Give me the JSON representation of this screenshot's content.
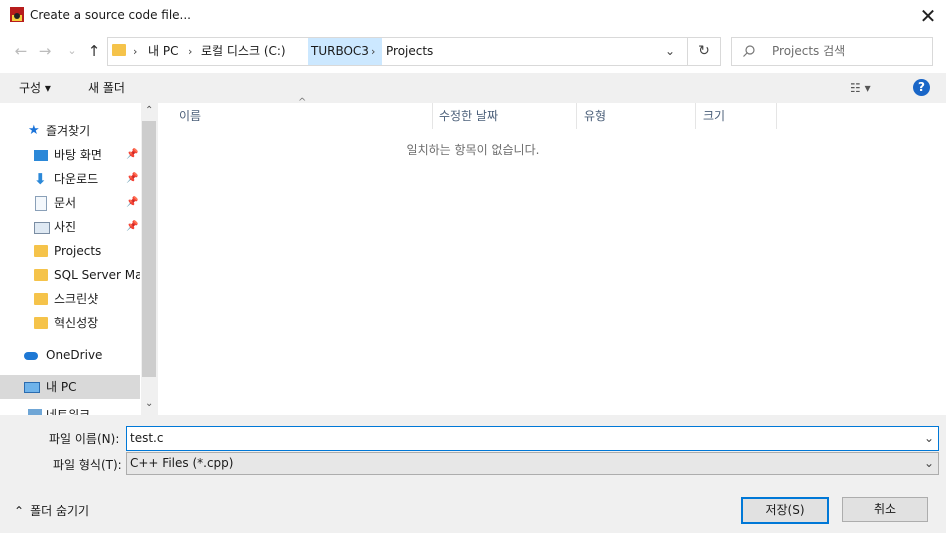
{
  "window": {
    "title": "Create a source code file...",
    "close_label": "✕"
  },
  "nav": {
    "back_label": "←",
    "forward_label": "→",
    "recent_label": "⌄",
    "up_label": "↑",
    "breadcrumbs": [
      "내 PC",
      "로컬 디스크 (C:)",
      "TURBOC3",
      "Projects"
    ],
    "separator": "›",
    "dropdown_label": "⌄",
    "refresh_label": "↻",
    "search_placeholder": "Projects 검색"
  },
  "toolbar": {
    "organize_label": "구성 ▾",
    "newfolder_label": "새 폴더",
    "view_label": "☷ ▾",
    "help_label": "?"
  },
  "sidebar": {
    "quick_access_label": "즐겨찾기",
    "items": [
      {
        "label": "바탕 화면",
        "icon": "desktop-icon",
        "pinned": true
      },
      {
        "label": "다운로드",
        "icon": "download-icon",
        "pinned": true
      },
      {
        "label": "문서",
        "icon": "document-icon",
        "pinned": true
      },
      {
        "label": "사진",
        "icon": "picture-icon",
        "pinned": true
      },
      {
        "label": "Projects",
        "icon": "folder-icon",
        "pinned": false
      },
      {
        "label": "SQL Server Man",
        "icon": "folder-icon",
        "pinned": false
      },
      {
        "label": "스크린샷",
        "icon": "folder-icon",
        "pinned": false
      },
      {
        "label": "혁신성장",
        "icon": "folder-icon",
        "pinned": false
      }
    ],
    "onedrive_label": "OneDrive",
    "thispc_label": "내 PC",
    "network_label": "네트워크",
    "pin_glyph": "📌"
  },
  "filelist": {
    "columns": [
      "이름",
      "수정한 날짜",
      "유형",
      "크기"
    ],
    "empty_message": "일치하는 항목이 없습니다."
  },
  "form": {
    "filename_label": "파일 이름(N):",
    "filename_value": "test.c",
    "filetype_label": "파일 형식(T):",
    "filetype_value": "C++ Files (*.cpp)",
    "hide_folders_label": "폴더 숨기기",
    "save_label": "저장(S)",
    "cancel_label": "취소"
  },
  "colors": {
    "accent": "#0078d7",
    "selected_crumb": "#cce8ff",
    "folder": "#f5c34a"
  }
}
